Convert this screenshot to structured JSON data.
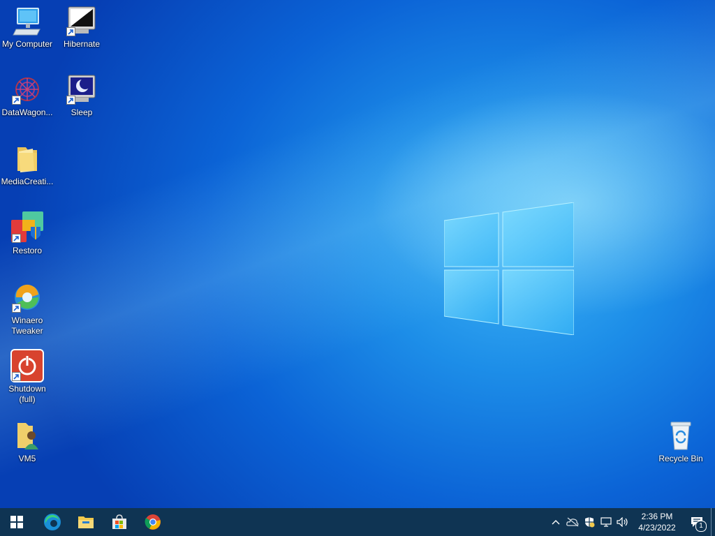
{
  "desktop": {
    "icons_left": [
      {
        "label": "My Computer",
        "icon": "computer-icon"
      },
      {
        "label": "Hibernate",
        "icon": "hibernate-icon",
        "shortcut": true
      },
      {
        "label": "DataWagon...",
        "icon": "datawagon-icon",
        "shortcut": true
      },
      {
        "label": "Sleep",
        "icon": "sleep-icon",
        "shortcut": true
      },
      {
        "label": "MediaCreati...",
        "icon": "folder-icon"
      },
      {
        "label": "Restoro",
        "icon": "restoro-icon",
        "shortcut": true
      },
      {
        "label": "Winaero Tweaker",
        "icon": "winaero-icon",
        "shortcut": true
      },
      {
        "label": "Shutdown (full)",
        "icon": "shutdown-icon",
        "shortcut": true
      },
      {
        "label": "VM5",
        "icon": "user-folder-icon"
      }
    ],
    "recycle_bin": {
      "label": "Recycle Bin",
      "icon": "recycle-bin-icon"
    }
  },
  "taskbar": {
    "pinned": [
      {
        "name": "start",
        "icon": "windows-start-icon"
      },
      {
        "name": "edge",
        "icon": "edge-icon"
      },
      {
        "name": "file-explorer",
        "icon": "file-explorer-icon"
      },
      {
        "name": "store",
        "icon": "store-icon"
      },
      {
        "name": "chrome",
        "icon": "chrome-icon"
      }
    ],
    "tray": {
      "icons": [
        "chevron-up-icon",
        "onedrive-icon",
        "security-icon",
        "network-icon",
        "volume-icon"
      ],
      "time": "2:36 PM",
      "date": "4/23/2022",
      "notification_count": "1"
    }
  },
  "colors": {
    "taskbar": "#0f3453",
    "wallpaper_accent": "#1d8ee8"
  }
}
